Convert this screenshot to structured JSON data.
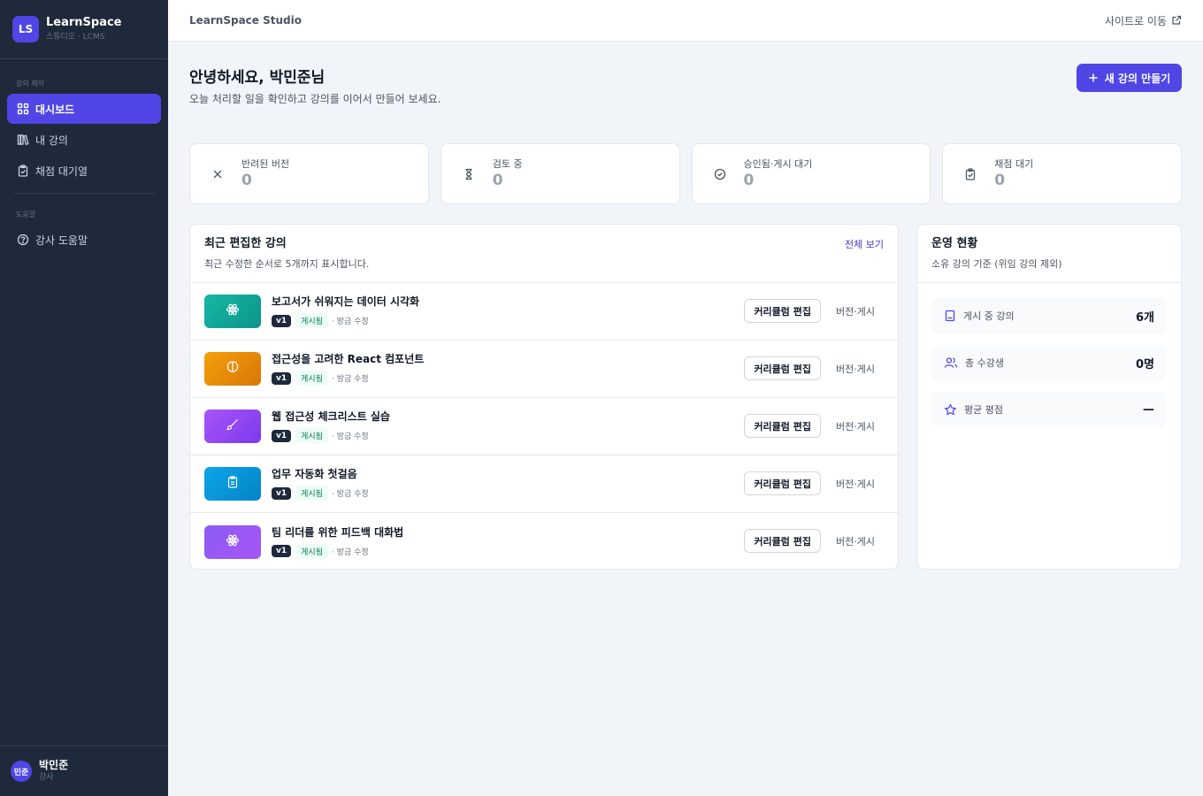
{
  "sidebar": {
    "logo": "LS",
    "name": "LearnSpace",
    "sub": "스튜디오 · LCMS",
    "section1": "강의 제작",
    "items": [
      {
        "label": "대시보드",
        "icon": "grid-icon"
      },
      {
        "label": "내 강의",
        "icon": "books-icon"
      },
      {
        "label": "채점 대기열",
        "icon": "clipboard-check-icon"
      }
    ],
    "section2": "도움말",
    "help": {
      "label": "강사 도움말",
      "icon": "help-circle-icon"
    },
    "user": {
      "avatar": "민준",
      "name": "박민준",
      "role": "강사"
    }
  },
  "topbar": {
    "title": "LearnSpace Studio",
    "site_link": "사이트로 이동"
  },
  "header": {
    "greeting": "안녕하세요, 박민준님",
    "subtitle": "오늘 처리할 일을 확인하고 강의를 이어서 만들어 보세요.",
    "new_button": "새 강의 만들기"
  },
  "stats": [
    {
      "label": "반려된 버전",
      "value": "0",
      "icon": "x-icon"
    },
    {
      "label": "검토 중",
      "value": "0",
      "icon": "hourglass-icon"
    },
    {
      "label": "승인됨·게시 대기",
      "value": "0",
      "icon": "check-circle-icon"
    },
    {
      "label": "채점 대기",
      "value": "0",
      "icon": "clipboard-check-icon"
    }
  ],
  "recent": {
    "title": "최근 편집한 강의",
    "subtitle": "최근 수정한 순서로 5개까지 표시합니다.",
    "view_all": "전체 보기",
    "edit_label": "커리큘럼 편집",
    "publish_label": "버전·게시",
    "courses": [
      {
        "title": "보고서가 쉬워지는 데이터 시각화",
        "version": "v1",
        "status": "게시됨",
        "edited": "· 방금 수정",
        "icon": "atom-icon",
        "color": "#14b8a6"
      },
      {
        "title": "접근성을 고려한 React 컴포넌트",
        "version": "v1",
        "status": "게시됨",
        "edited": "· 방금 수정",
        "icon": "brain-icon",
        "color": "#f59e0b"
      },
      {
        "title": "웹 접근성 체크리스트 실습",
        "version": "v1",
        "status": "게시됨",
        "edited": "· 방금 수정",
        "icon": "brush-icon",
        "color": "#a855f7"
      },
      {
        "title": "업무 자동화 첫걸음",
        "version": "v1",
        "status": "게시됨",
        "edited": "· 방금 수정",
        "icon": "clipboard-icon",
        "color": "#0ea5e9"
      },
      {
        "title": "팀 리더를 위한 피드백 대화법",
        "version": "v1",
        "status": "게시됨",
        "edited": "· 방금 수정",
        "icon": "atom-icon",
        "color": "#8b5cf6"
      }
    ]
  },
  "ops": {
    "title": "운영 현황",
    "subtitle": "소유 강의 기준 (위임 강의 제외)",
    "items": [
      {
        "label": "게시 중 강의",
        "value": "6개",
        "icon": "document-icon"
      },
      {
        "label": "총 수강생",
        "value": "0명",
        "icon": "users-icon"
      },
      {
        "label": "평균 평점",
        "value": "—",
        "icon": "star-icon"
      }
    ]
  }
}
